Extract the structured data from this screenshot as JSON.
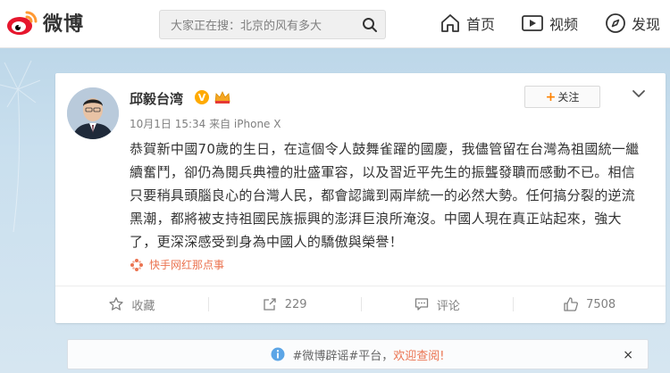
{
  "header": {
    "logo_text": "微博",
    "search_placeholder": "大家正在搜：北京的风有多大",
    "nav": [
      {
        "label": "首页",
        "icon": "home-icon"
      },
      {
        "label": "视频",
        "icon": "video-icon"
      },
      {
        "label": "发现",
        "icon": "compass-icon"
      }
    ]
  },
  "post": {
    "username": "邱毅台湾",
    "verified_badge": "V",
    "meta": "10月1日 15:34 来自 iPhone X",
    "follow_label": "关注",
    "follow_plus": "+",
    "text": "恭賀新中國70歲的生日，在這個令人鼓舞雀躍的國慶，我儘管留在台灣為祖國統一繼續奮鬥，卻仍為閱兵典禮的壯盛軍容，以及習近平先生的振聾發聵而感動不已。相信只要稍具頭腦良心的台灣人民，都會認識到兩岸統一的必然大勢。任何搞分裂的逆流黑潮，都將被支持祖國民族振興的澎湃巨浪所淹沒。中國人現在真正站起來，強大了，更深深感受到身為中國人的驕傲與榮譽！",
    "source": "快手网红那点事",
    "actions": {
      "favorite": "收藏",
      "repost": "229",
      "comment": "评论",
      "like": "7508"
    }
  },
  "notice": {
    "prefix": "#微博辟谣#平台，",
    "link": "欢迎查阅!",
    "close": "×"
  },
  "colors": {
    "accent": "#ff8200",
    "link_orange": "#eb7350",
    "page_bg": "#c9dfee"
  }
}
